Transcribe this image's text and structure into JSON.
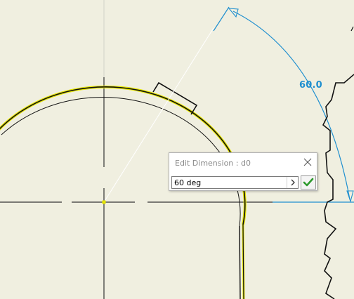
{
  "sketch": {
    "dimension_value": "60.0"
  },
  "dialog": {
    "title": "Edit Dimension : d0",
    "input_value": "60 deg"
  },
  "icons": {
    "close": "close-icon",
    "expand": "chevron-right-icon",
    "accept": "checkmark-icon"
  },
  "colors": {
    "background": "#f0efe0",
    "dimension": "#1f8fcf",
    "geometry": "#111111",
    "highlight": "#e6e600",
    "accept_check": "#2e9a2e"
  }
}
